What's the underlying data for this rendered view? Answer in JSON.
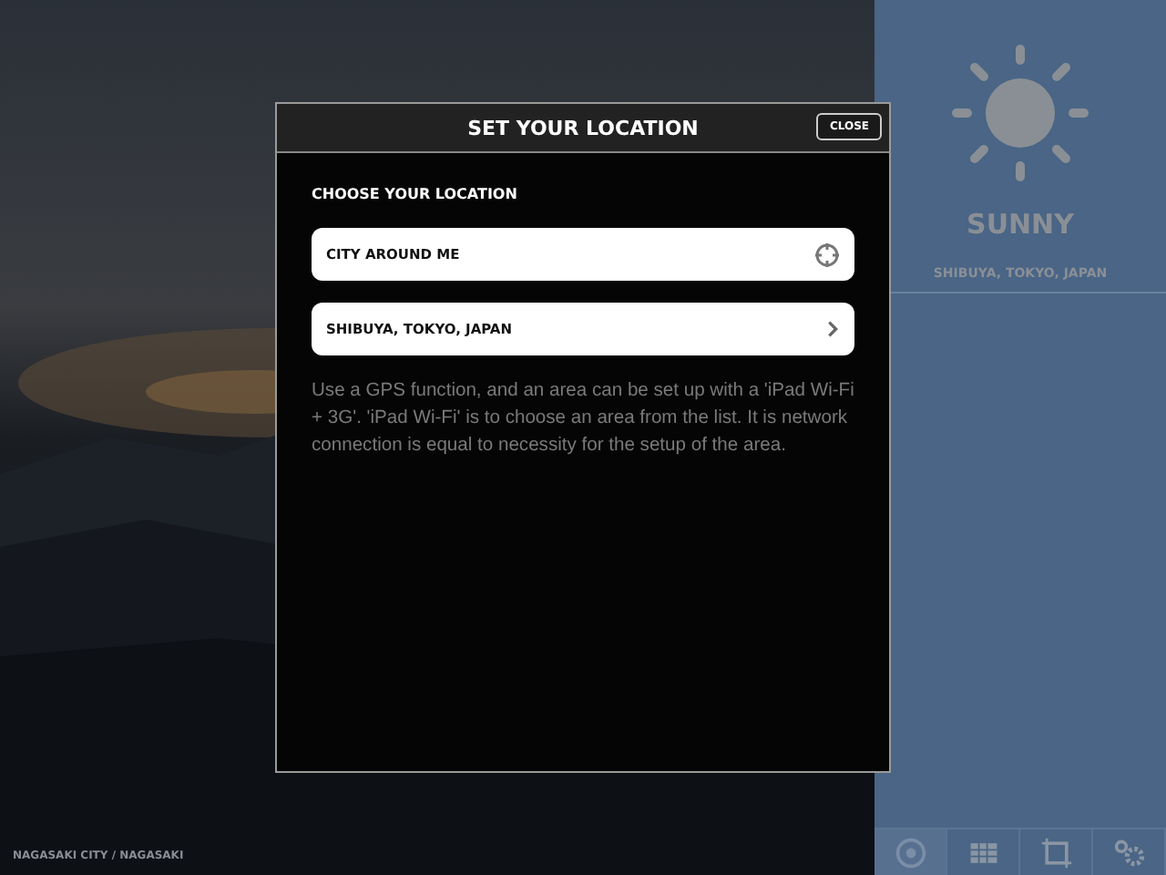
{
  "background": {
    "caption": "NAGASAKI CITY / NAGASAKI"
  },
  "weather": {
    "condition": "SUNNY",
    "location": "SHIBUYA, TOKYO, JAPAN"
  },
  "toolbar": [
    {
      "kind": "globe",
      "selected": true
    },
    {
      "kind": "calendar",
      "selected": false
    },
    {
      "kind": "frame",
      "selected": false
    },
    {
      "kind": "settings",
      "selected": false
    }
  ],
  "dialog": {
    "title": "SET YOUR LOCATION",
    "close": "CLOSE",
    "heading": "CHOOSE YOUR LOCATION",
    "options": [
      {
        "label": "CITY AROUND ME",
        "kind": "gps"
      },
      {
        "label": "SHIBUYA, TOKYO, JAPAN",
        "kind": "chevron"
      }
    ],
    "note": "Use a GPS function, and an area can be set up with a 'iPad Wi-Fi + 3G'. 'iPad Wi-Fi' is to choose an area from the list. It is network connection is equal to necessity for the setup of the area."
  }
}
